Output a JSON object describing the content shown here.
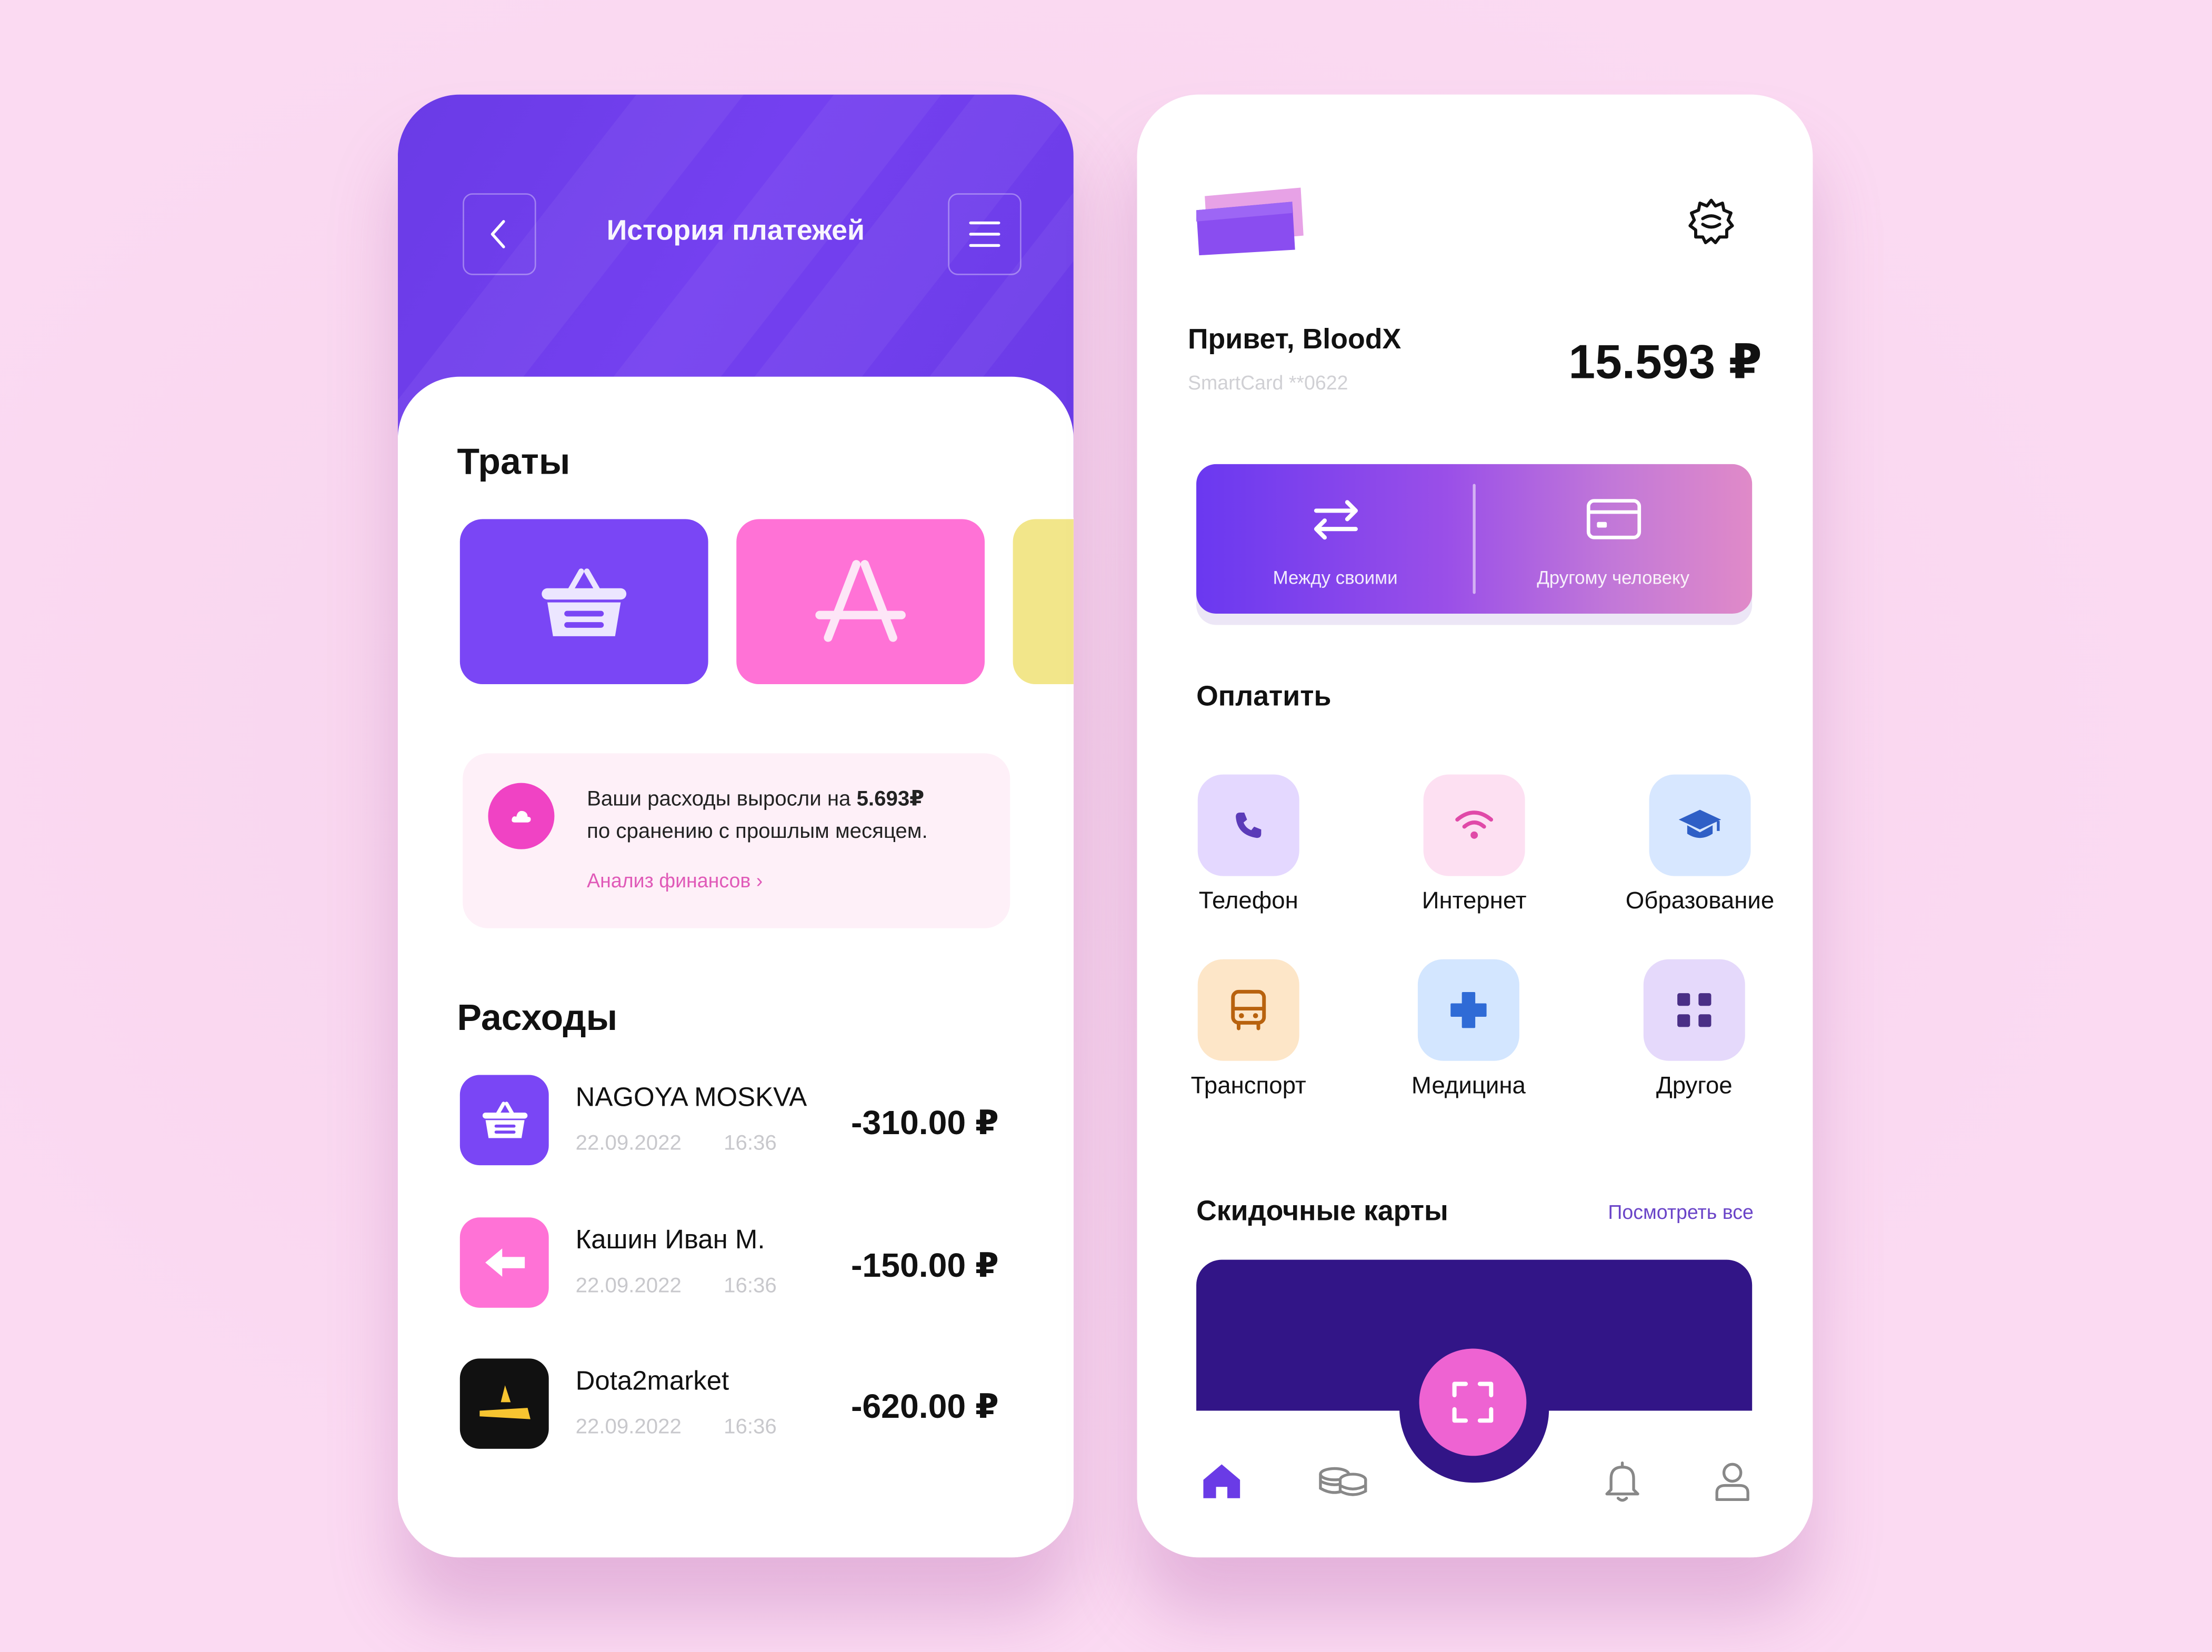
{
  "payment_history": {
    "title": "История платежей",
    "spending_heading": "Траты",
    "categories": [
      {
        "name": "basket-category",
        "color": "#7a46f5"
      },
      {
        "name": "appstore-category",
        "color": "#ff72d6"
      },
      {
        "name": "third-category",
        "color": "#f2e68a"
      }
    ],
    "insight": {
      "text_prefix": "Ваши расходы выросли на ",
      "amount": "5.693₽",
      "text_suffix": "по сранению с прошлым месяцем.",
      "link_label": "Анализ финансов ›"
    },
    "expenses_heading": "Расходы",
    "transactions": [
      {
        "name": "NAGOYA MOSKVA",
        "date": "22.09.2022",
        "time": "16:36",
        "amount": "-310.00 ₽",
        "icon": "basket-icon",
        "color": "#7a46f5"
      },
      {
        "name": "Кашин Иван М.",
        "date": "22.09.2022",
        "time": "16:36",
        "amount": "-150.00 ₽",
        "icon": "arrow-left-icon",
        "color": "#ff72d6"
      },
      {
        "name": "Dota2market",
        "date": "22.09.2022",
        "time": "16:36",
        "amount": "-620.00 ₽",
        "icon": "dota2market-logo-icon",
        "color": "#111111"
      }
    ]
  },
  "home": {
    "greeting": "Привет, BloodX",
    "card_number": "SmartCard **0622",
    "balance": "15.593 ₽",
    "transfers": [
      {
        "label": "Между своими",
        "icon": "transfer-arrows-icon"
      },
      {
        "label": "Другому человеку",
        "icon": "credit-card-icon"
      }
    ],
    "pay_heading": "Оплатить",
    "services": [
      {
        "label": "Телефон",
        "icon": "phone-icon",
        "bg": "#e4d8ff"
      },
      {
        "label": "Интернет",
        "icon": "wifi-icon",
        "bg": "#fde0f2"
      },
      {
        "label": "Образование",
        "icon": "graduation-cap-icon",
        "bg": "#d7e7ff"
      },
      {
        "label": "Транспорт",
        "icon": "bus-icon",
        "bg": "#fde6c8"
      },
      {
        "label": "Медицина",
        "icon": "medical-cross-icon",
        "bg": "#d3e6ff"
      },
      {
        "label": "Другое",
        "icon": "grid-icon",
        "bg": "#e5d9fb"
      }
    ],
    "discount_heading": "Скидочные карты",
    "see_all": "Посмотреть все",
    "bottom_nav": [
      "home-icon",
      "coins-icon",
      "scan-icon",
      "bell-icon",
      "profile-icon"
    ]
  },
  "colors": {
    "page_background": "#fbdaf2",
    "header_purple": "#6a3be6",
    "accent_pink": "#ee63d2",
    "discount_card": "#321587"
  }
}
